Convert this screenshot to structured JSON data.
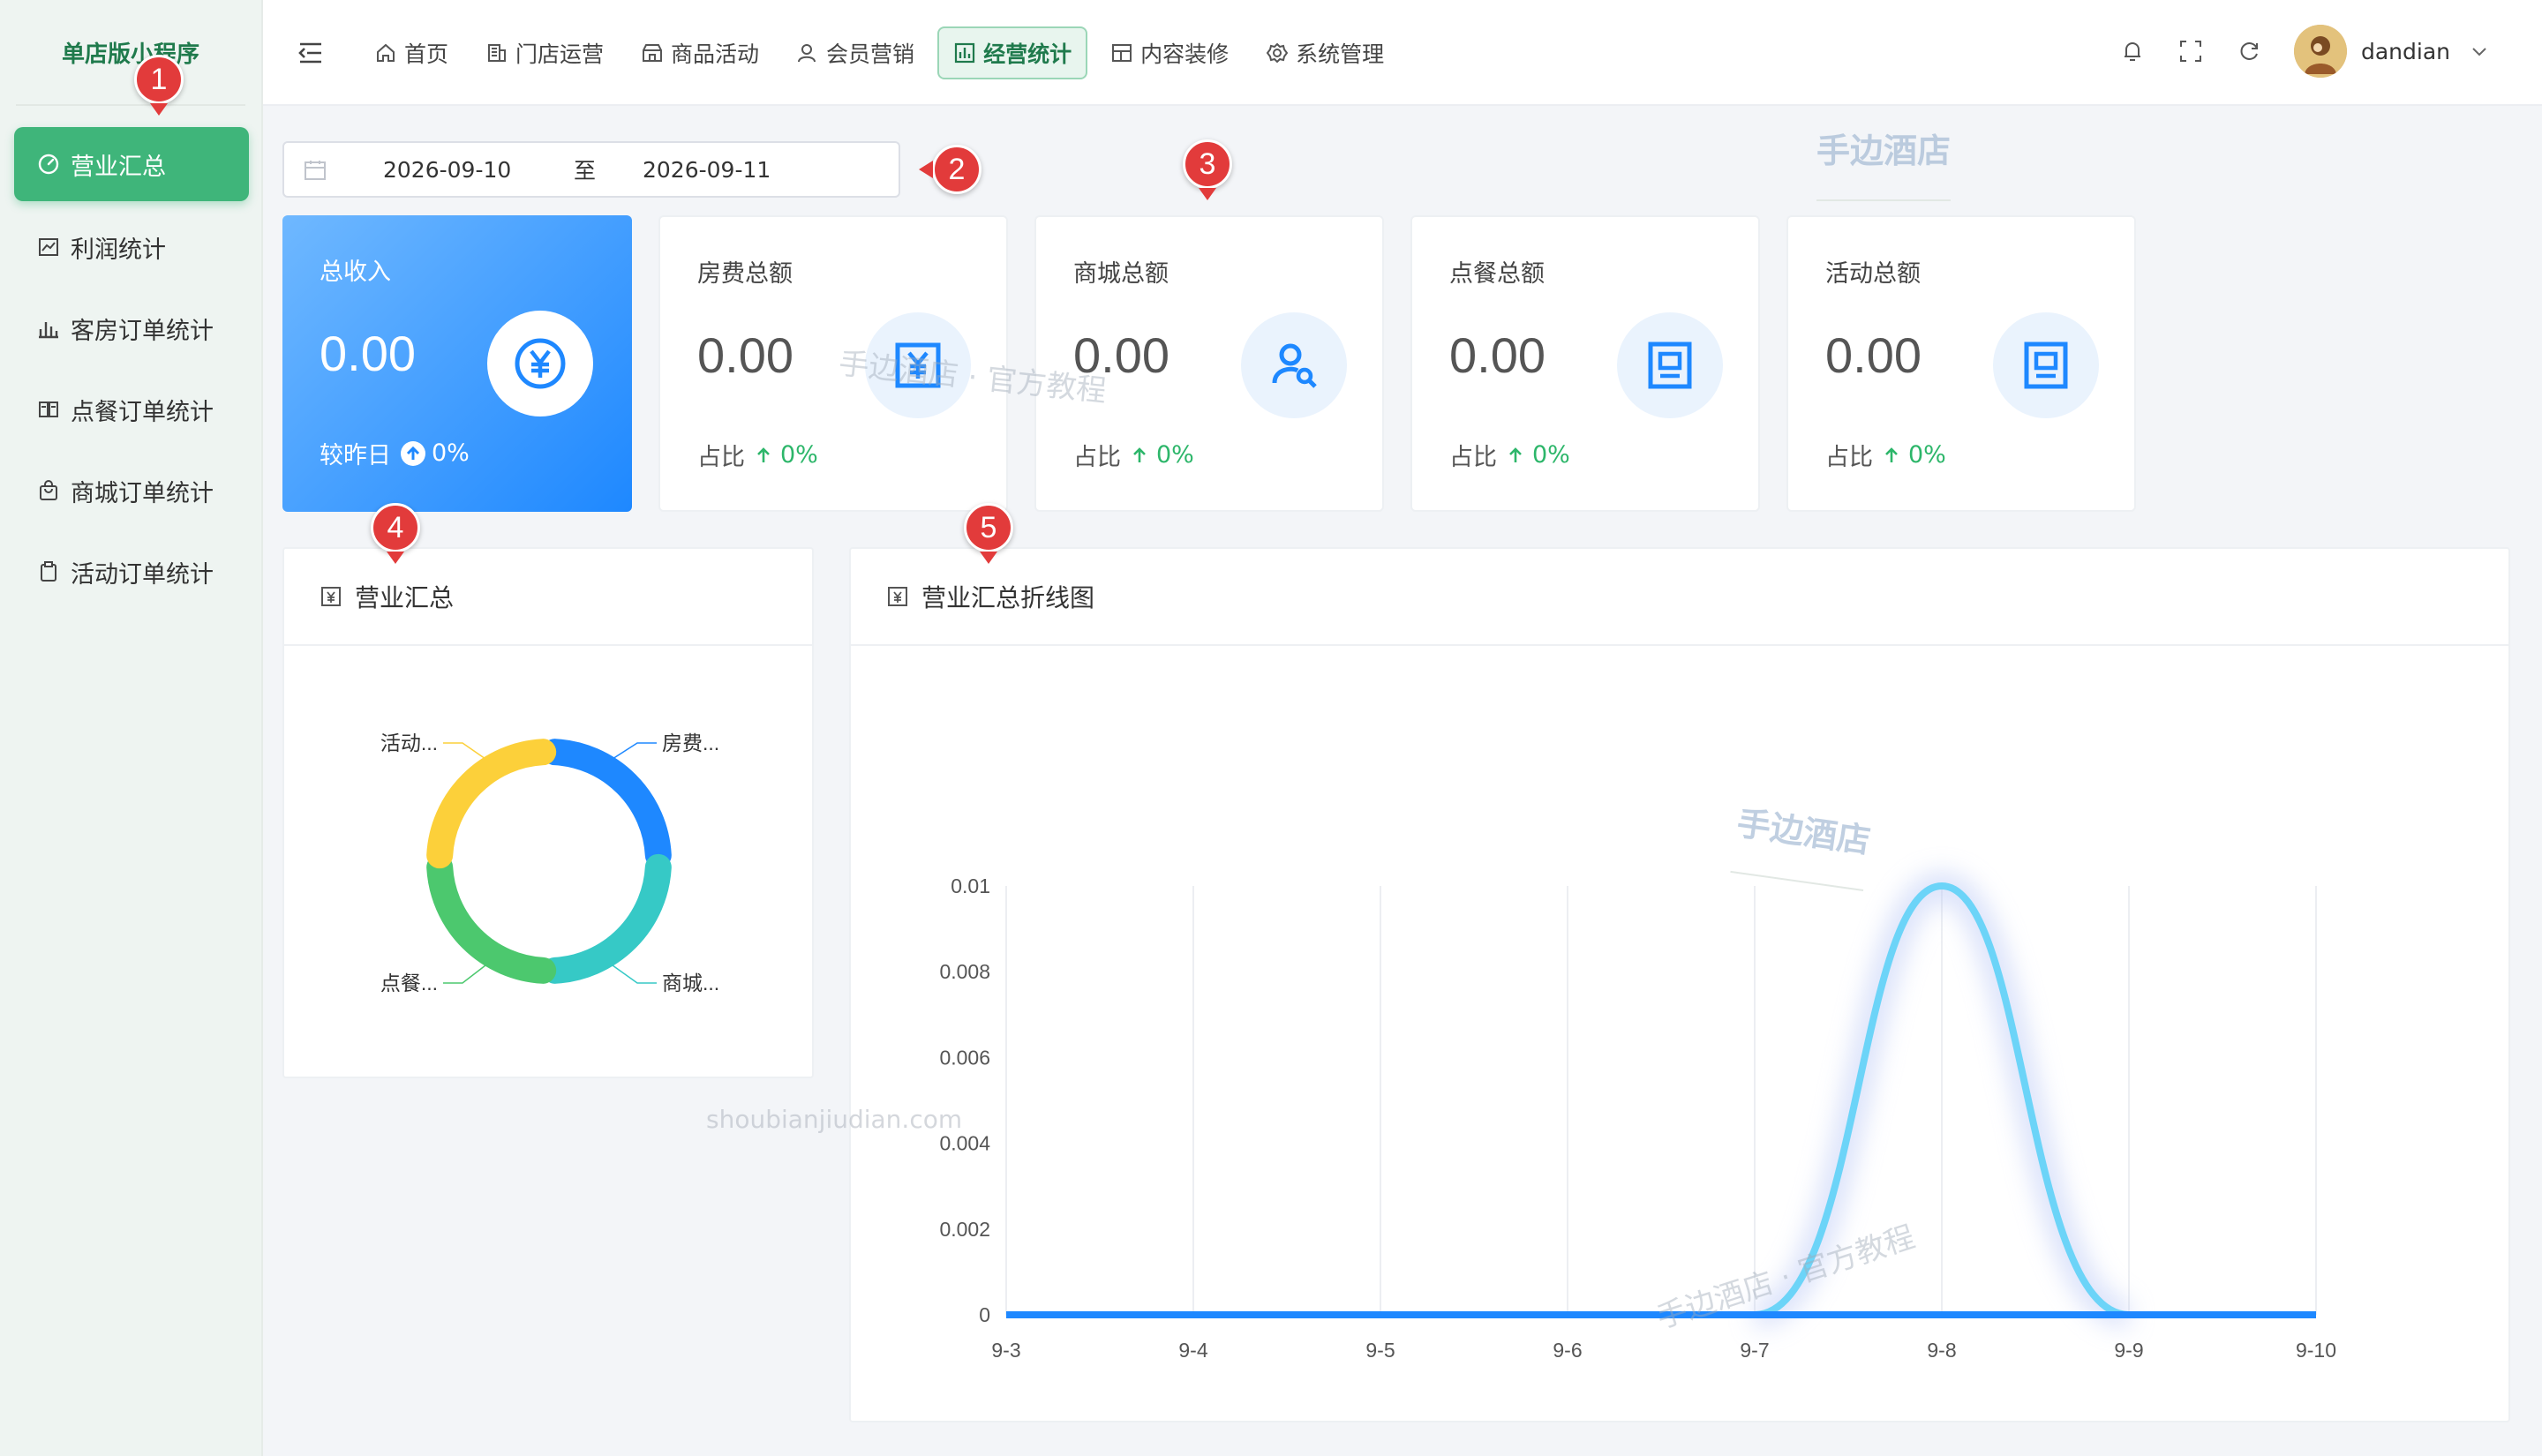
{
  "brand": "单店版小程序",
  "sidebar": {
    "items": [
      {
        "label": "营业汇总",
        "icon": "dashboard-icon",
        "active": true
      },
      {
        "label": "利润统计",
        "icon": "trend-chart-icon"
      },
      {
        "label": "客房订单统计",
        "icon": "bar-chart-icon"
      },
      {
        "label": "点餐订单统计",
        "icon": "dining-icon"
      },
      {
        "label": "商城订单统计",
        "icon": "shopping-bag-icon"
      },
      {
        "label": "活动订单统计",
        "icon": "clipboard-icon"
      }
    ]
  },
  "nav": {
    "items": [
      {
        "label": "首页",
        "icon": "home-icon"
      },
      {
        "label": "门店运营",
        "icon": "building-icon"
      },
      {
        "label": "商品活动",
        "icon": "store-icon"
      },
      {
        "label": "会员营销",
        "icon": "member-icon"
      },
      {
        "label": "经营统计",
        "icon": "bar-chart-icon",
        "active": true
      },
      {
        "label": "内容装修",
        "icon": "layout-icon"
      },
      {
        "label": "系统管理",
        "icon": "gear-icon"
      }
    ]
  },
  "user": {
    "name": "dandian"
  },
  "daterange": {
    "start": "2026-09-10",
    "sep": "至",
    "end": "2026-09-11"
  },
  "cards": [
    {
      "title": "总收入",
      "value": "0.00",
      "foot_label": "较昨日",
      "pct": "0%",
      "icon": "yuan-circle-icon"
    },
    {
      "title": "房费总额",
      "value": "0.00",
      "foot_label": "占比",
      "pct": "0%",
      "icon": "yuan-box-icon"
    },
    {
      "title": "商城总额",
      "value": "0.00",
      "foot_label": "占比",
      "pct": "0%",
      "icon": "user-search-icon"
    },
    {
      "title": "点餐总额",
      "value": "0.00",
      "foot_label": "占比",
      "pct": "0%",
      "icon": "portrait-box-icon"
    },
    {
      "title": "活动总额",
      "value": "0.00",
      "foot_label": "占比",
      "pct": "0%",
      "icon": "portrait-box-icon"
    }
  ],
  "panels": {
    "summary_title": "营业汇总",
    "line_title": "营业汇总折线图"
  },
  "markers": [
    "1",
    "2",
    "3",
    "4",
    "5"
  ],
  "watermarks": {
    "brand": "手边酒店",
    "tutorial": "手边酒店 · 官方教程",
    "url": "shoubianjiudian.com"
  },
  "colors": {
    "accent_green": "#3fb57a",
    "primary_blue": "#1e88ff",
    "marker_red": "#e23b3b",
    "positive": "#2db66a"
  },
  "chart_data": [
    {
      "type": "pie",
      "title": "",
      "categories": [
        "房费...",
        "商城...",
        "点餐...",
        "活动..."
      ],
      "values": [
        1,
        1,
        1,
        1
      ],
      "colors": [
        "#1e88ff",
        "#36c9c6",
        "#4cc86e",
        "#fcd03a"
      ]
    },
    {
      "type": "line",
      "title": "",
      "x": [
        "9-3",
        "9-4",
        "9-5",
        "9-6",
        "9-7",
        "9-8",
        "9-9",
        "9-10"
      ],
      "ylim": [
        0,
        0.01
      ],
      "yticks": [
        "0",
        "0.002",
        "0.004",
        "0.006",
        "0.008",
        "0.01"
      ],
      "series": [
        {
          "values": [
            0,
            0,
            0,
            0,
            0,
            0.01,
            0,
            0
          ],
          "color": "#6cd4f8",
          "smooth": true
        },
        {
          "values": [
            0,
            0,
            0,
            0,
            0,
            0,
            0,
            0
          ],
          "color": "#1e88ff"
        }
      ],
      "grid": true
    }
  ]
}
